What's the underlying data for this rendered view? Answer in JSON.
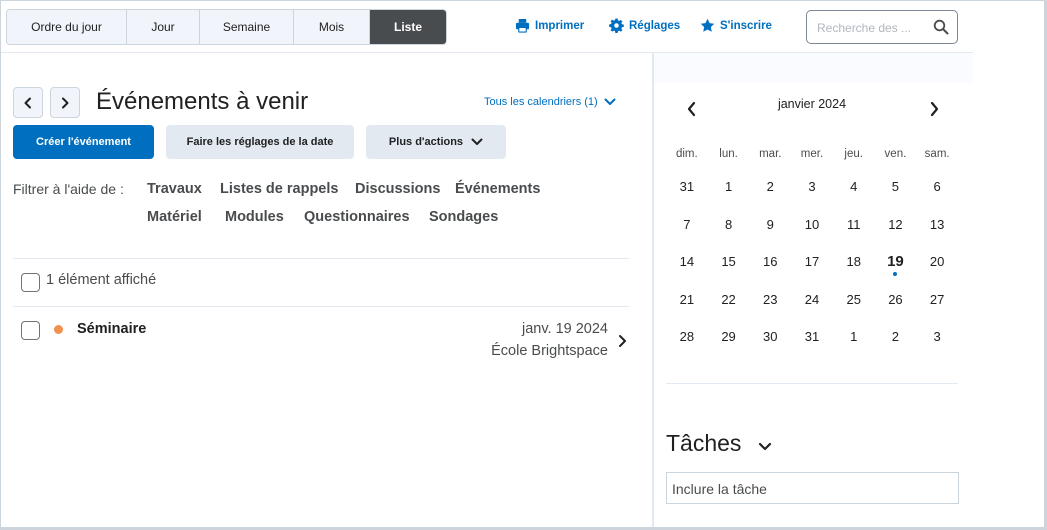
{
  "view_tabs": [
    {
      "label": "Ordre du jour",
      "active": false
    },
    {
      "label": "Jour",
      "active": false
    },
    {
      "label": "Semaine",
      "active": false
    },
    {
      "label": "Mois",
      "active": false
    },
    {
      "label": "Liste",
      "active": true
    }
  ],
  "toolbar": {
    "print_label": "Imprimer",
    "settings_label": "Réglages",
    "subscribe_label": "S'inscrire"
  },
  "search": {
    "placeholder": "Recherche des ..."
  },
  "header": {
    "title": "Événements à venir",
    "calendars_label": "Tous les calendriers (1)"
  },
  "actions": {
    "create_label": "Créer l'événement",
    "date_settings_label": "Faire les réglages de la date",
    "more_label": "Plus d'actions"
  },
  "filters": {
    "label": "Filtrer à l'aide de :",
    "row1": [
      "Travaux",
      "Listes de rappels",
      "Discussions",
      "Événements"
    ],
    "row2": [
      "Matériel",
      "Modules",
      "Questionnaires",
      "Sondages"
    ]
  },
  "list": {
    "count_label": "1 élément affiché",
    "items": [
      {
        "title": "Séminaire",
        "date": "janv. 19 2024",
        "org": "École Brightspace",
        "dot_color": "#f0914d"
      }
    ]
  },
  "calendar": {
    "month_label": "janvier 2024",
    "weekdays": [
      "dim.",
      "lun.",
      "mar.",
      "mer.",
      "jeu.",
      "ven.",
      "sam."
    ],
    "weeks": [
      [
        "31",
        "1",
        "2",
        "3",
        "4",
        "5",
        "6"
      ],
      [
        "7",
        "8",
        "9",
        "10",
        "11",
        "12",
        "13"
      ],
      [
        "14",
        "15",
        "16",
        "17",
        "18",
        "19",
        "20"
      ],
      [
        "21",
        "22",
        "23",
        "24",
        "25",
        "26",
        "27"
      ],
      [
        "28",
        "29",
        "30",
        "31",
        "1",
        "2",
        "3"
      ]
    ],
    "today": "19"
  },
  "tasks": {
    "title": "Tâches",
    "input_placeholder": "Inclure la tâche"
  },
  "colors": {
    "accent": "#006fbf",
    "active_tab": "#494c4e",
    "event_dot": "#f0914d"
  }
}
